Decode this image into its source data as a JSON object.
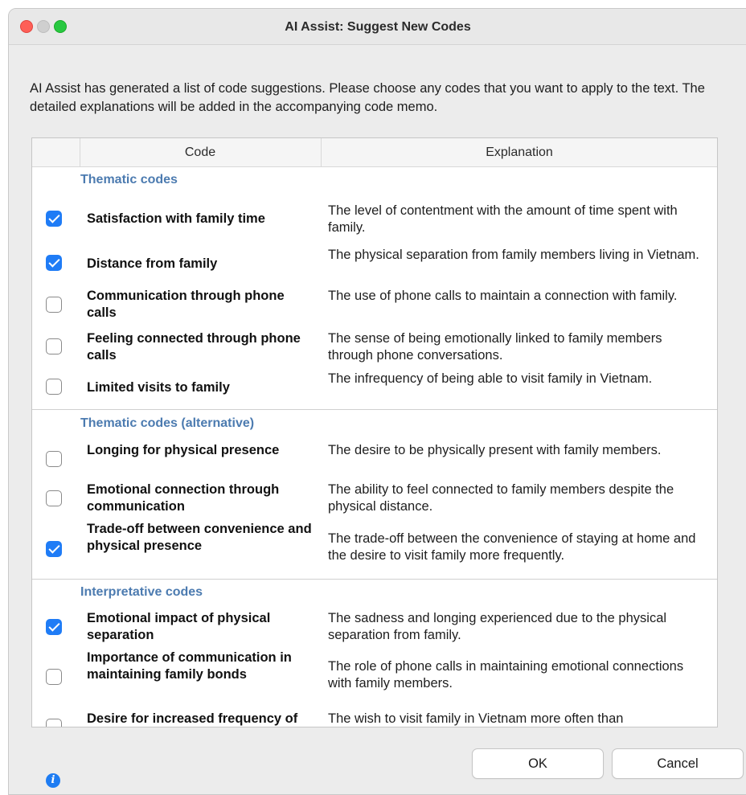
{
  "window": {
    "title": "AI Assist: Suggest New Codes"
  },
  "intro": "AI Assist has generated a list of code suggestions. Please choose any codes that you want to apply to the text. The detailed explanations will be added in the accompanying code memo.",
  "table": {
    "headers": {
      "code": "Code",
      "explanation": "Explanation"
    },
    "sections": [
      {
        "title": "Thematic codes",
        "rows": [
          {
            "code": "Satisfaction with family time",
            "explanation": "The level of contentment with the amount of time spent with family.",
            "checked": true
          },
          {
            "code": "Distance from family",
            "explanation": "The physical separation from family members living in Vietnam.",
            "checked": true
          },
          {
            "code": "Communication through phone calls",
            "explanation": "The use of phone calls to maintain a connection with family.",
            "checked": false
          },
          {
            "code": "Feeling connected through phone calls",
            "explanation": "The sense of being emotionally linked to family members through phone conversations.",
            "checked": false
          },
          {
            "code": "Limited visits to family",
            "explanation": "The infrequency of being able to visit family in Vietnam.",
            "checked": false
          }
        ]
      },
      {
        "title": "Thematic codes (alternative)",
        "rows": [
          {
            "code": "Longing for physical presence",
            "explanation": "The desire to be physically present with family members.",
            "checked": false
          },
          {
            "code": "Emotional connection through communication",
            "explanation": "The ability to feel connected to family members despite the physical distance.",
            "checked": false
          },
          {
            "code": "Trade-off between convenience and physical presence",
            "explanation": "The trade-off between the convenience of staying at home and the desire to visit family more frequently.",
            "checked": true
          }
        ]
      },
      {
        "title": "Interpretative codes",
        "rows": [
          {
            "code": "Emotional impact of physical separation",
            "explanation": "The sadness and longing experienced due to the physical separation from family.",
            "checked": true
          },
          {
            "code": "Importance of communication in maintaining family bonds",
            "explanation": "The role of phone calls in maintaining emotional connections with family members.",
            "checked": false
          },
          {
            "code": "Desire for increased frequency of visits",
            "explanation": "The wish to visit family in Vietnam more often than",
            "checked": false
          }
        ]
      }
    ]
  },
  "buttons": {
    "ok": "OK",
    "cancel": "Cancel"
  },
  "icons": {
    "info": "info-icon"
  },
  "colors": {
    "accent": "#1f7cf6",
    "section_title": "#4c7bb0",
    "close": "#fe5f57",
    "maximize": "#28c840"
  }
}
